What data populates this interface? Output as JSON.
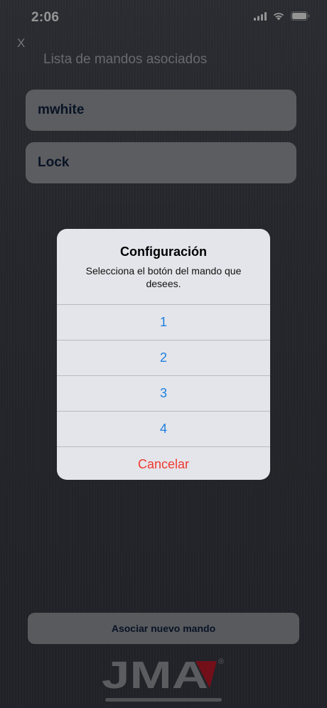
{
  "status_bar": {
    "time": "2:06"
  },
  "header": {
    "close_label": "X",
    "title": "Lista de mandos asociados"
  },
  "list": {
    "items": [
      {
        "label": "mwhite"
      },
      {
        "label": "Lock"
      }
    ]
  },
  "alert": {
    "title": "Configuración",
    "message": "Selecciona el botón del mando que desees.",
    "options": [
      {
        "label": "1"
      },
      {
        "label": "2"
      },
      {
        "label": "3"
      },
      {
        "label": "4"
      }
    ],
    "cancel_label": "Cancelar"
  },
  "footer": {
    "associate_button_label": "Asociar nuevo mando",
    "logo_text": "JMA",
    "logo_mark": "®"
  },
  "colors": {
    "option_blue": "#1d7fe0",
    "cancel_red": "#f0392f",
    "logo_red": "#c41a2c",
    "text_navy": "#0f2140"
  }
}
